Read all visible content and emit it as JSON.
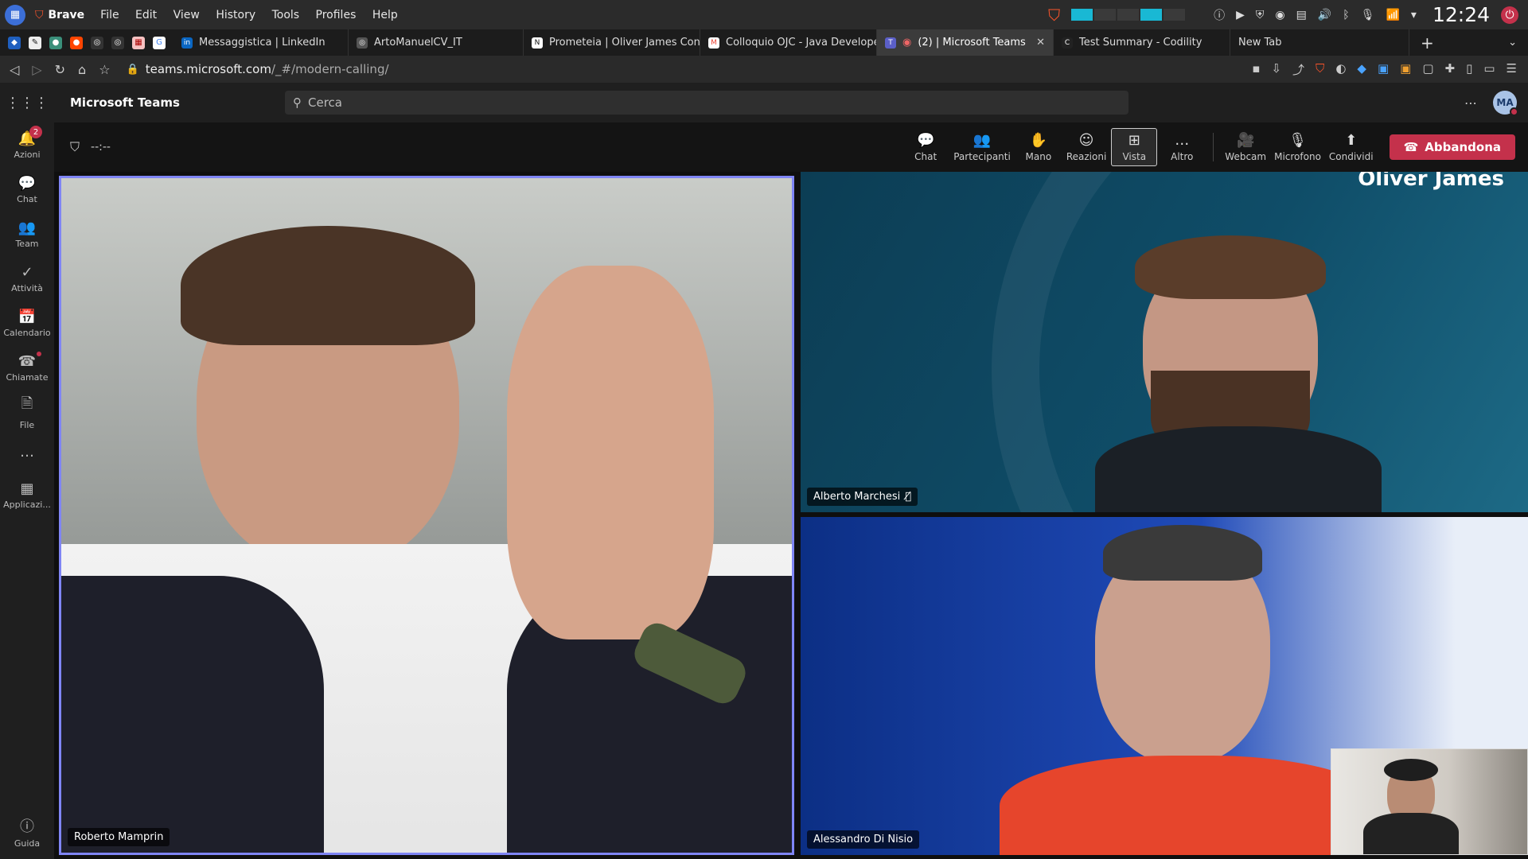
{
  "os": {
    "app_name": "Brave",
    "menu": [
      "File",
      "Edit",
      "View",
      "History",
      "Tools",
      "Profiles",
      "Help"
    ],
    "clock": "12:24"
  },
  "browser": {
    "tabs": [
      {
        "title": "Messaggistica | LinkedIn",
        "fav": "in",
        "color": "#0a66c2",
        "active": false
      },
      {
        "title": "ArtoManuelCV_IT",
        "fav": "◎",
        "color": "#555555",
        "active": false
      },
      {
        "title": "Prometeia | Oliver James Consu",
        "fav": "N",
        "color": "#ffffff",
        "active": false
      },
      {
        "title": "Colloquio OJC - Java Developer",
        "fav": "M",
        "color": "#ea4335",
        "active": false
      },
      {
        "title": "(2) | Microsoft Teams",
        "fav": "T",
        "color": "#5b5fc7",
        "active": true
      },
      {
        "title": "Test Summary - Codility",
        "fav": "C",
        "color": "#222222",
        "active": false
      },
      {
        "title": "New Tab",
        "fav": "",
        "color": "",
        "active": false
      }
    ],
    "url_host": "teams.microsoft.com",
    "url_path": "/_#/modern-calling/"
  },
  "teams": {
    "title": "Microsoft Teams",
    "search_placeholder": "Cerca",
    "user_initials": "MA",
    "rail": [
      {
        "label": "Azioni",
        "icon": "bell-icon",
        "glyph": "🔔",
        "badge": "2"
      },
      {
        "label": "Chat",
        "icon": "chat-icon",
        "glyph": "💬"
      },
      {
        "label": "Team",
        "icon": "team-icon",
        "glyph": "👥"
      },
      {
        "label": "Attività",
        "icon": "activity-icon",
        "glyph": "✓"
      },
      {
        "label": "Calendario",
        "icon": "calendar-icon",
        "glyph": "📅"
      },
      {
        "label": "Chiamate",
        "icon": "phone-icon",
        "glyph": "☎",
        "dot": true
      },
      {
        "label": "File",
        "icon": "file-icon",
        "glyph": "🗎"
      },
      {
        "label": "…",
        "icon": "more-icon",
        "glyph": ""
      },
      {
        "label": "Applicazi...",
        "icon": "apps-icon",
        "glyph": "▦"
      }
    ],
    "help_label": "Guida"
  },
  "call": {
    "timer": "--:--",
    "controls": [
      {
        "label": "Chat",
        "icon": "chat-icon",
        "glyph": "💬"
      },
      {
        "label": "Partecipanti",
        "icon": "participants-icon",
        "glyph": "👥"
      },
      {
        "label": "Mano",
        "icon": "raise-hand-icon",
        "glyph": "✋"
      },
      {
        "label": "Reazioni",
        "icon": "reactions-icon",
        "glyph": "☺"
      },
      {
        "label": "Vista",
        "icon": "view-icon",
        "glyph": "⊞",
        "selected": true
      },
      {
        "label": "Altro",
        "icon": "more-icon",
        "glyph": "…"
      }
    ],
    "media": [
      {
        "label": "Webcam",
        "icon": "camera-icon",
        "glyph": "🎥"
      },
      {
        "label": "Microfono",
        "icon": "microphone-icon",
        "glyph": "🎙"
      },
      {
        "label": "Condividi",
        "icon": "share-icon",
        "glyph": "⬆"
      }
    ],
    "leave_label": "Abbandona",
    "participants": [
      {
        "name": "Roberto Mamprin",
        "muted": false
      },
      {
        "name": "Alberto Marchesi",
        "muted": true
      },
      {
        "name": "Alessandro Di Nisio",
        "muted": false
      }
    ],
    "background_brand": "Oliver James"
  }
}
